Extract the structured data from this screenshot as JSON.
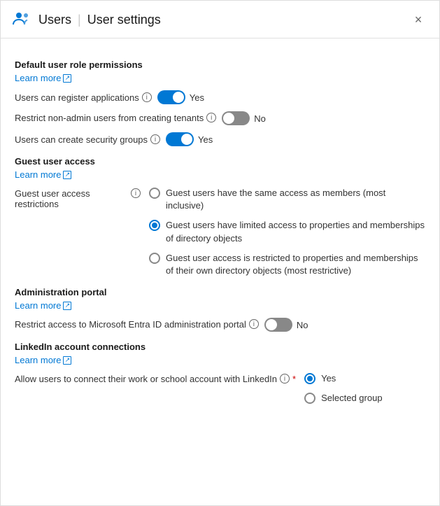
{
  "header": {
    "icon_label": "users-icon",
    "title": "Users",
    "subtitle": "User settings",
    "close_label": "×"
  },
  "sections": {
    "default_user_role": {
      "title": "Default user role permissions",
      "learn_more_label": "Learn more",
      "settings": [
        {
          "id": "register_apps",
          "label": "Users can register applications",
          "has_info": true,
          "toggle": "on",
          "toggle_text": "Yes"
        },
        {
          "id": "restrict_nonadmin",
          "label": "Restrict non-admin users from creating tenants",
          "has_info": true,
          "toggle": "off",
          "toggle_text": "No"
        },
        {
          "id": "create_security_groups",
          "label": "Users can create security groups",
          "has_info": true,
          "toggle": "on",
          "toggle_text": "Yes"
        }
      ]
    },
    "guest_user_access": {
      "title": "Guest user access",
      "learn_more_label": "Learn more",
      "restriction_label": "Guest user access restrictions",
      "has_info": true,
      "options": [
        {
          "id": "option1",
          "selected": false,
          "text": "Guest users have the same access as members (most inclusive)"
        },
        {
          "id": "option2",
          "selected": true,
          "text": "Guest users have limited access to properties and memberships of directory objects"
        },
        {
          "id": "option3",
          "selected": false,
          "text": "Guest user access is restricted to properties and memberships of their own directory objects (most restrictive)"
        }
      ]
    },
    "administration_portal": {
      "title": "Administration portal",
      "learn_more_label": "Learn more",
      "settings": [
        {
          "id": "restrict_entra",
          "label": "Restrict access to Microsoft Entra ID administration portal",
          "has_info": true,
          "toggle": "off",
          "toggle_text": "No"
        }
      ]
    },
    "linkedin": {
      "title": "LinkedIn account connections",
      "learn_more_label": "Learn more",
      "restriction_label": "Allow users to connect their work or school account with LinkedIn",
      "has_info": true,
      "required": true,
      "options": [
        {
          "id": "li_yes",
          "selected": true,
          "text": "Yes"
        },
        {
          "id": "li_selected_group",
          "selected": false,
          "text": "Selected group"
        }
      ]
    }
  },
  "icons": {
    "info": "i",
    "external_link": "↗",
    "close": "×"
  }
}
